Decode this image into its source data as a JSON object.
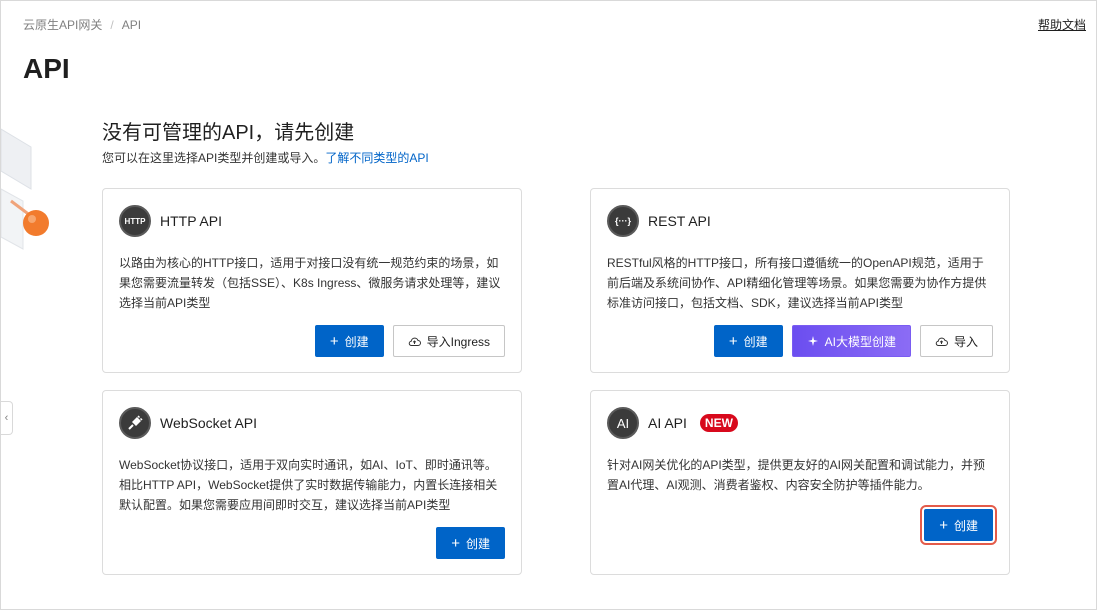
{
  "breadcrumb": {
    "parent": "云原生API网关",
    "separator": "/",
    "current": "API"
  },
  "help_link": "帮助文档",
  "page_title": "API",
  "empty": {
    "title": "没有可管理的API，请先创建",
    "desc": "您可以在这里选择API类型并创建或导入。",
    "link": "了解不同类型的API"
  },
  "cards": {
    "http": {
      "title": "HTTP API",
      "icon": "http-icon",
      "icon_text": "HTTP",
      "desc": "以路由为核心的HTTP接口，适用于对接口没有统一规范约束的场景，如果您需要流量转发（包括SSE）、K8s Ingress、微服务请求处理等，建议选择当前API类型",
      "create": "创建",
      "import_ingress": "导入Ingress"
    },
    "rest": {
      "title": "REST API",
      "icon": "rest-icon",
      "icon_text": "{···}",
      "desc": "RESTful风格的HTTP接口，所有接口遵循统一的OpenAPI规范，适用于前后端及系统间协作、API精细化管理等场景。如果您需要为协作方提供标准访问接口，包括文档、SDK，建议选择当前API类型",
      "create": "创建",
      "ai_create": "AI大模型创建",
      "import": "导入"
    },
    "websocket": {
      "title": "WebSocket API",
      "icon": "plug-icon",
      "desc": "WebSocket协议接口，适用于双向实时通讯，如AI、IoT、即时通讯等。相比HTTP API，WebSocket提供了实时数据传输能力，内置长连接相关默认配置。如果您需要应用间即时交互，建议选择当前API类型",
      "create": "创建"
    },
    "ai": {
      "title": "AI API",
      "icon": "ai-icon",
      "icon_text": "AI",
      "badge": "NEW",
      "desc": "针对AI网关优化的API类型，提供更友好的AI网关配置和调试能力，并预置AI代理、AI观测、消费者鉴权、内容安全防护等插件能力。",
      "create": "创建"
    }
  },
  "colors": {
    "primary": "#0064c8",
    "badge": "#d8091c",
    "highlight": "#e45b4a",
    "ai_button": "#7a5cf2"
  }
}
